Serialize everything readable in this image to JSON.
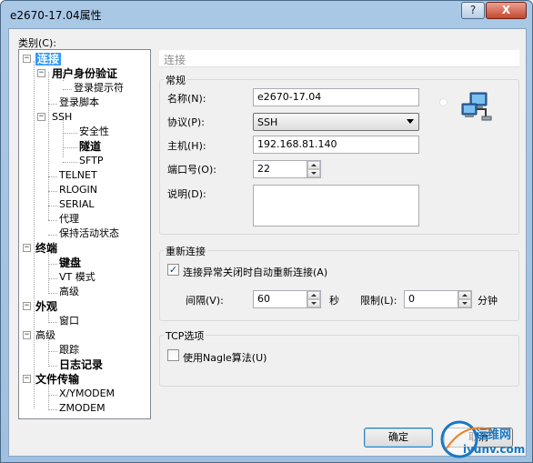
{
  "window": {
    "title": "e2670-17.04属性",
    "help_btn": "?",
    "close_btn": "X"
  },
  "category_label": "类别(C):",
  "tree": {
    "n1": "连接",
    "n2": "用户身份验证",
    "n3": "登录提示符",
    "n4": "登录脚本",
    "n5": "SSH",
    "n6": "安全性",
    "n7": "隧道",
    "n8": "SFTP",
    "n9": "TELNET",
    "n10": "RLOGIN",
    "n11": "SERIAL",
    "n12": "代理",
    "n13": "保持活动状态",
    "n14": "终端",
    "n15": "键盘",
    "n16": "VT 模式",
    "n17": "高级",
    "n18": "外观",
    "n19": "窗口",
    "n20": "高级",
    "n21": "跟踪",
    "n22": "日志记录",
    "n23": "文件传输",
    "n24": "X/YMODEM",
    "n25": "ZMODEM"
  },
  "panel_header": "连接",
  "general": {
    "title": "常规",
    "name_label": "名称(N):",
    "name_value": "e2670-17.04",
    "protocol_label": "协议(P):",
    "protocol_value": "SSH",
    "host_label": "主机(H):",
    "host_value": "192.168.81.140",
    "port_label": "端口号(O):",
    "port_value": "22",
    "desc_label": "说明(D):",
    "desc_value": ""
  },
  "reconnect": {
    "title": "重新连接",
    "checkbox_label": "连接异常关闭时自动重新连接(A)",
    "checked": true,
    "check_mark": "✓",
    "interval_label": "间隔(V):",
    "interval_value": "60",
    "sec_unit": "秒",
    "limit_label": "限制(L):",
    "limit_value": "0",
    "min_unit": "分钟"
  },
  "tcp": {
    "title": "TCP选项",
    "nagle_label": "使用Nagle算法(U)",
    "nagle_checked": false
  },
  "buttons": {
    "ok": "确定",
    "cancel": "取消"
  },
  "watermark": {
    "line1": "运维网",
    "line2": "iyunv.com"
  },
  "colors": {
    "selection": "#3399ff",
    "watermark_blue": "#1a78c2"
  },
  "icons": {
    "tree_expand": "⊟",
    "network": "network-computers-icon"
  }
}
